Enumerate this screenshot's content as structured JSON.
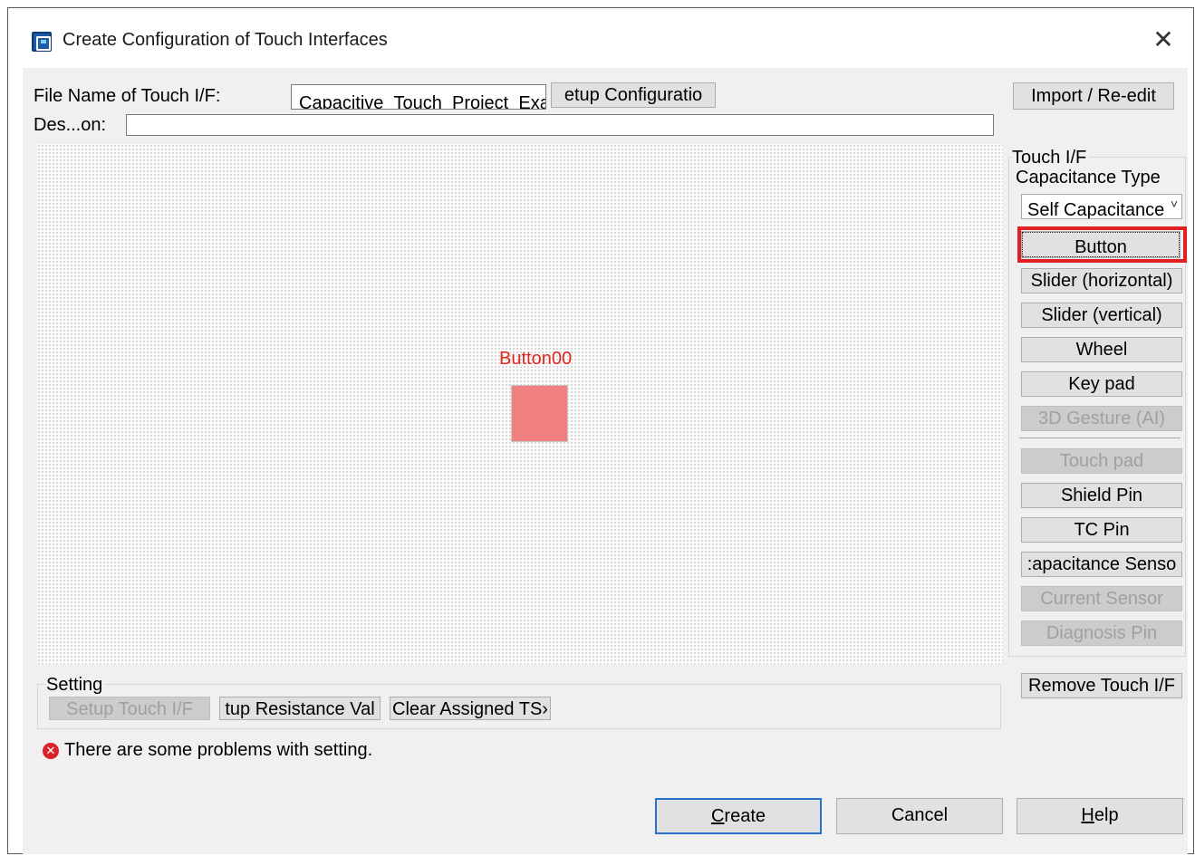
{
  "window": {
    "title": "Create Configuration of Touch Interfaces"
  },
  "file_name": {
    "label": "File Name of Touch I/F:",
    "value": "Capacitive_Touch_Project_Exa",
    "setup_button": "etup Configuratio"
  },
  "description": {
    "label": "Des...on:",
    "value": ""
  },
  "import_button": "Import / Re-edit",
  "canvas": {
    "component_label": "Button00",
    "component_color": "#f08080"
  },
  "touch_if_panel": {
    "group_title": "Touch I/F",
    "capacitance_type_label": "Capacitance Type",
    "capacitance_type_value": "Self Capacitance",
    "buttons": [
      {
        "label": "Button",
        "enabled": true,
        "highlighted": true
      },
      {
        "label": "Slider (horizontal)",
        "enabled": true
      },
      {
        "label": "Slider (vertical)",
        "enabled": true
      },
      {
        "label": "Wheel",
        "enabled": true
      },
      {
        "label": "Key pad",
        "enabled": true
      },
      {
        "label": "3D Gesture (AI)",
        "enabled": false
      },
      {
        "label": "Touch pad",
        "enabled": false
      },
      {
        "label": "Shield Pin",
        "enabled": true
      },
      {
        "label": "TC Pin",
        "enabled": true
      },
      {
        "label": ":apacitance Senso",
        "enabled": true
      },
      {
        "label": "Current Sensor",
        "enabled": false
      },
      {
        "label": "Diagnosis Pin",
        "enabled": false
      }
    ],
    "highlight_color": "#e02020"
  },
  "remove_button": "Remove Touch I/F",
  "setting": {
    "group_title": "Setting",
    "setup_touch_if": "Setup Touch I/F",
    "setup_resistance": "tup Resistance Val",
    "clear_assigned": "Clear Assigned TS›"
  },
  "status": {
    "message": "There are some problems with setting."
  },
  "footer": {
    "create_prefix": "C",
    "create_rest": "reate",
    "cancel": "Cancel",
    "help_prefix": "H",
    "help_rest": "elp"
  }
}
